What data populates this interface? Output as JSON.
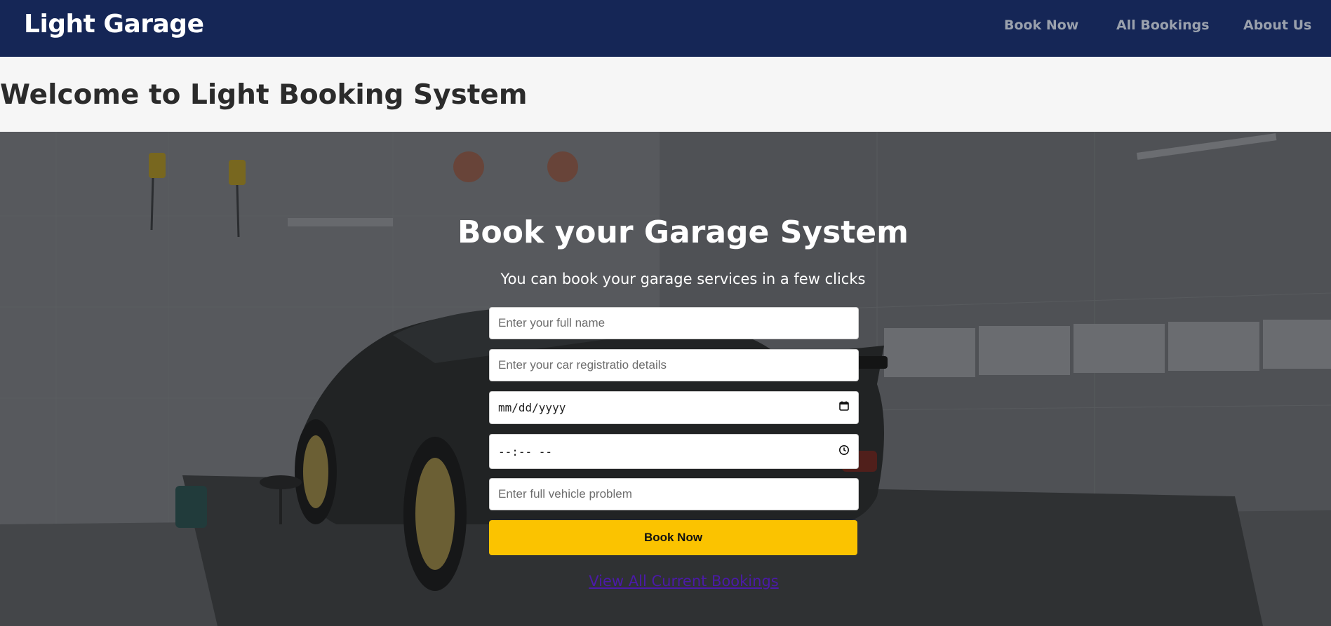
{
  "navbar": {
    "brand": "Light Garage",
    "links": [
      "Book Now",
      "All Bookings",
      "About Us"
    ]
  },
  "welcome": {
    "title": "Welcome to Light Booking System"
  },
  "hero": {
    "title": "Book your Garage System",
    "subtitle": "You can book your garage services in a few clicks"
  },
  "form": {
    "name_placeholder": "Enter your full name",
    "registration_placeholder": "Enter your car registratio details",
    "date_value": "mm/dd/yyyy",
    "time_value": "--:-- --",
    "problem_placeholder": "Enter full vehicle problem",
    "submit_label": "Book Now"
  },
  "footer_link": {
    "label": "View All Current Bookings"
  },
  "icons": {
    "date": "calendar-icon",
    "time": "clock-icon"
  },
  "colors": {
    "navbar": "#152656",
    "button": "#fbc300",
    "link": "#4b1aa8"
  }
}
